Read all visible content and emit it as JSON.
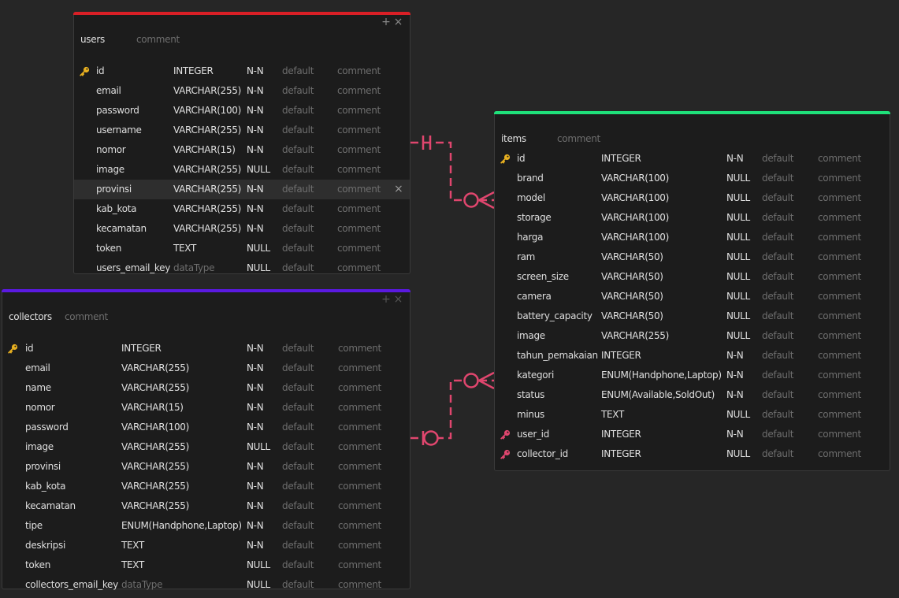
{
  "colors": {
    "users_accent": "#d91f26",
    "items_accent": "#1fe07a",
    "collectors_accent": "#5a19e0",
    "relation": "#e0466e",
    "primary_key": "#e8b020",
    "foreign_key": "#e0466e"
  },
  "controls": {
    "add": "+",
    "close": "×",
    "delete_row": "×"
  },
  "tables": {
    "users": {
      "name": "users",
      "comment": "comment",
      "columns": [
        {
          "name": "id",
          "type": "INTEGER",
          "null": "N-N",
          "default": "default",
          "comment": "comment",
          "key": "primary"
        },
        {
          "name": "email",
          "type": "VARCHAR(255)",
          "null": "N-N",
          "default": "default",
          "comment": "comment",
          "key": ""
        },
        {
          "name": "password",
          "type": "VARCHAR(100)",
          "null": "N-N",
          "default": "default",
          "comment": "comment",
          "key": ""
        },
        {
          "name": "username",
          "type": "VARCHAR(255)",
          "null": "N-N",
          "default": "default",
          "comment": "comment",
          "key": ""
        },
        {
          "name": "nomor",
          "type": "VARCHAR(15)",
          "null": "N-N",
          "default": "default",
          "comment": "comment",
          "key": ""
        },
        {
          "name": "image",
          "type": "VARCHAR(255)",
          "null": "NULL",
          "default": "default",
          "comment": "comment",
          "key": ""
        },
        {
          "name": "provinsi",
          "type": "VARCHAR(255)",
          "null": "N-N",
          "default": "default",
          "comment": "comment",
          "key": "",
          "highlight": true
        },
        {
          "name": "kab_kota",
          "type": "VARCHAR(255)",
          "null": "N-N",
          "default": "default",
          "comment": "comment",
          "key": ""
        },
        {
          "name": "kecamatan",
          "type": "VARCHAR(255)",
          "null": "N-N",
          "default": "default",
          "comment": "comment",
          "key": ""
        },
        {
          "name": "token",
          "type": "TEXT",
          "null": "NULL",
          "default": "default",
          "comment": "comment",
          "key": ""
        },
        {
          "name": "users_email_key",
          "type": "dataType",
          "null": "NULL",
          "default": "default",
          "comment": "comment",
          "key": "",
          "placeholder": true
        }
      ]
    },
    "collectors": {
      "name": "collectors",
      "comment": "comment",
      "columns": [
        {
          "name": "id",
          "type": "INTEGER",
          "null": "N-N",
          "default": "default",
          "comment": "comment",
          "key": "primary"
        },
        {
          "name": "email",
          "type": "VARCHAR(255)",
          "null": "N-N",
          "default": "default",
          "comment": "comment",
          "key": ""
        },
        {
          "name": "name",
          "type": "VARCHAR(255)",
          "null": "N-N",
          "default": "default",
          "comment": "comment",
          "key": ""
        },
        {
          "name": "nomor",
          "type": "VARCHAR(15)",
          "null": "N-N",
          "default": "default",
          "comment": "comment",
          "key": ""
        },
        {
          "name": "password",
          "type": "VARCHAR(100)",
          "null": "N-N",
          "default": "default",
          "comment": "comment",
          "key": ""
        },
        {
          "name": "image",
          "type": "VARCHAR(255)",
          "null": "NULL",
          "default": "default",
          "comment": "comment",
          "key": ""
        },
        {
          "name": "provinsi",
          "type": "VARCHAR(255)",
          "null": "N-N",
          "default": "default",
          "comment": "comment",
          "key": ""
        },
        {
          "name": "kab_kota",
          "type": "VARCHAR(255)",
          "null": "N-N",
          "default": "default",
          "comment": "comment",
          "key": ""
        },
        {
          "name": "kecamatan",
          "type": "VARCHAR(255)",
          "null": "N-N",
          "default": "default",
          "comment": "comment",
          "key": ""
        },
        {
          "name": "tipe",
          "type": "ENUM(Handphone,Laptop)",
          "null": "N-N",
          "default": "default",
          "comment": "comment",
          "key": ""
        },
        {
          "name": "deskripsi",
          "type": "TEXT",
          "null": "N-N",
          "default": "default",
          "comment": "comment",
          "key": ""
        },
        {
          "name": "token",
          "type": "TEXT",
          "null": "NULL",
          "default": "default",
          "comment": "comment",
          "key": ""
        },
        {
          "name": "collectors_email_key",
          "type": "dataType",
          "null": "NULL",
          "default": "default",
          "comment": "comment",
          "key": "",
          "placeholder": true
        }
      ]
    },
    "items": {
      "name": "items",
      "comment": "comment",
      "columns": [
        {
          "name": "id",
          "type": "INTEGER",
          "null": "N-N",
          "default": "default",
          "comment": "comment",
          "key": "primary"
        },
        {
          "name": "brand",
          "type": "VARCHAR(100)",
          "null": "NULL",
          "default": "default",
          "comment": "comment",
          "key": ""
        },
        {
          "name": "model",
          "type": "VARCHAR(100)",
          "null": "NULL",
          "default": "default",
          "comment": "comment",
          "key": ""
        },
        {
          "name": "storage",
          "type": "VARCHAR(100)",
          "null": "NULL",
          "default": "default",
          "comment": "comment",
          "key": ""
        },
        {
          "name": "harga",
          "type": "VARCHAR(100)",
          "null": "NULL",
          "default": "default",
          "comment": "comment",
          "key": ""
        },
        {
          "name": "ram",
          "type": "VARCHAR(50)",
          "null": "NULL",
          "default": "default",
          "comment": "comment",
          "key": ""
        },
        {
          "name": "screen_size",
          "type": "VARCHAR(50)",
          "null": "NULL",
          "default": "default",
          "comment": "comment",
          "key": ""
        },
        {
          "name": "camera",
          "type": "VARCHAR(50)",
          "null": "NULL",
          "default": "default",
          "comment": "comment",
          "key": ""
        },
        {
          "name": "battery_capacity",
          "type": "VARCHAR(50)",
          "null": "NULL",
          "default": "default",
          "comment": "comment",
          "key": ""
        },
        {
          "name": "image",
          "type": "VARCHAR(255)",
          "null": "NULL",
          "default": "default",
          "comment": "comment",
          "key": ""
        },
        {
          "name": "tahun_pemakaian",
          "type": "INTEGER",
          "null": "N-N",
          "default": "default",
          "comment": "comment",
          "key": ""
        },
        {
          "name": "kategori",
          "type": "ENUM(Handphone,Laptop)",
          "null": "N-N",
          "default": "default",
          "comment": "comment",
          "key": ""
        },
        {
          "name": "status",
          "type": "ENUM(Available,SoldOut)",
          "null": "N-N",
          "default": "default",
          "comment": "comment",
          "key": ""
        },
        {
          "name": "minus",
          "type": "TEXT",
          "null": "NULL",
          "default": "default",
          "comment": "comment",
          "key": ""
        },
        {
          "name": "user_id",
          "type": "INTEGER",
          "null": "N-N",
          "default": "default",
          "comment": "comment",
          "key": "foreign"
        },
        {
          "name": "collector_id",
          "type": "INTEGER",
          "null": "NULL",
          "default": "default",
          "comment": "comment",
          "key": "foreign"
        }
      ]
    }
  }
}
